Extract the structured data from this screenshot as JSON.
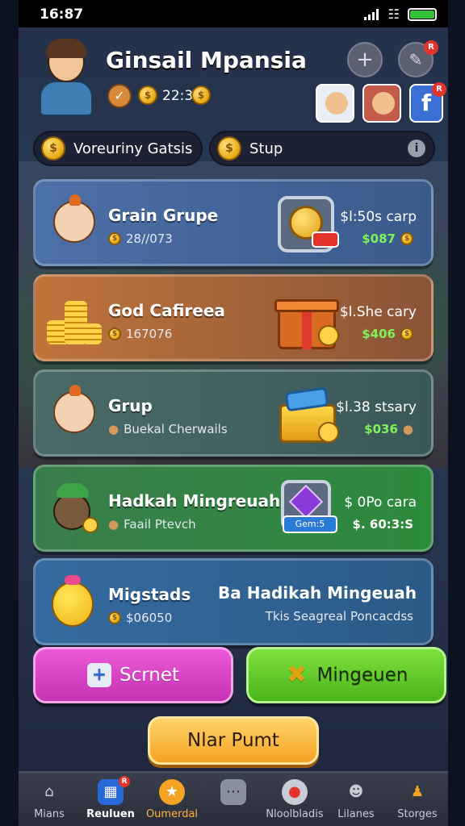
{
  "status_bar": {
    "time": "16:87"
  },
  "header": {
    "title": "Ginsail Mpansia",
    "coin_value": "22:3",
    "add_icon": "plus-icon",
    "edit_icon": "pencil-icon",
    "edit_badge": "R",
    "fb_badge": "R",
    "fb_label": "f"
  },
  "pills": [
    {
      "label": "Voreuriny Gatsis"
    },
    {
      "label": "Stup",
      "info": "i"
    }
  ],
  "cards": [
    {
      "name": "Grain Grupe",
      "sub": "28//073",
      "right_top": "$l:50s carp",
      "right_bottom": "$087",
      "color": "#3f5f90"
    },
    {
      "name": "God Cafireea",
      "sub": "167076",
      "right_top": "$l.She cary",
      "right_bottom": "$406",
      "color": "#a3602e"
    },
    {
      "name": "Grup",
      "sub": "Buekal Cherwails",
      "right_top": "$l.38 stsary",
      "right_bottom": "$036",
      "color": "#3d5a5e"
    },
    {
      "name": "Hadkah Mingreuah",
      "sub": "Faail Ptevch",
      "right_top": "$ 0Po cara",
      "right_bottom": "$. 60:3:S",
      "prize_label": "Gem:5",
      "color": "#2f7b45"
    },
    {
      "name": "Migstads",
      "sub": "$06050",
      "right_top": "Ba Hadikah Mingeuah",
      "right_bottom": "Tkis Seagreal Poncacdss",
      "color": "#2e5a88"
    }
  ],
  "actions": {
    "left_label": "Scrnet",
    "right_label": "Mingeuen",
    "play_label": "Nlar Pumt"
  },
  "tabs": [
    {
      "label": "Mians",
      "icon": "home-icon"
    },
    {
      "label": "Reuluen",
      "icon": "calendar-icon",
      "badge": "R"
    },
    {
      "label": "Oumerdal",
      "icon": "star-icon"
    },
    {
      "label": "",
      "icon": "chat-icon"
    },
    {
      "label": "Nloolbladis",
      "icon": "map-pin-icon"
    },
    {
      "label": "Lilanes",
      "icon": "group-icon"
    },
    {
      "label": "Storges",
      "icon": "profile-icon"
    }
  ],
  "colors": {
    "accent_green": "#7ff25a",
    "play_orange": "#f5a322",
    "scan_pink": "#d73fc6",
    "mine_green": "#5bc02a",
    "active_tab": "#ffb43a"
  }
}
